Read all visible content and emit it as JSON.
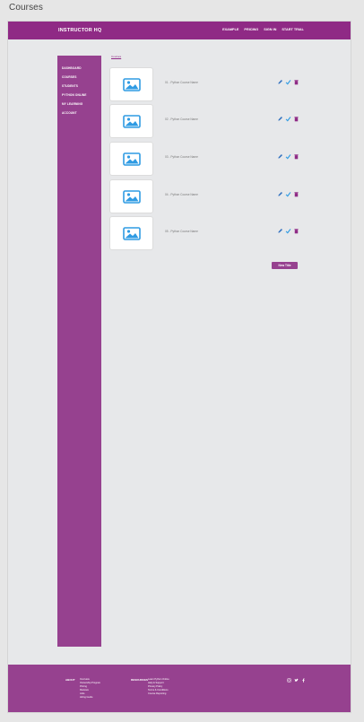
{
  "page_label": "Courses",
  "header": {
    "brand": "INSTRUCTOR HQ",
    "nav": [
      "EXAMPLE",
      "PRICING",
      "SIGN IN",
      "START TRIAL"
    ]
  },
  "sidebar": {
    "items": [
      "DASHBOARD",
      "COURSES",
      "STUDENTS",
      "PYTHON ONLINE",
      "MY LEARNING",
      "ACCOUNT"
    ]
  },
  "breadcrumb": "Courses",
  "courses": [
    {
      "name": "01 - Python Course Name"
    },
    {
      "name": "02 - Python Course Name"
    },
    {
      "name": "03 - Python Course Name"
    },
    {
      "name": "04 - Python Course Name"
    },
    {
      "name": "05 - Python Course Name"
    }
  ],
  "new_button_label": "New Title",
  "footer": {
    "col1": {
      "heading": "ABOUT",
      "links": [
        "Overview",
        "Ownership Program",
        "Pricing",
        "Reviews",
        "Jobs",
        "Hiring Guide"
      ]
    },
    "col2": {
      "heading": "RESOURCES",
      "links": [
        "Learn Python Online",
        "Help & Support",
        "Privacy Policy",
        "Terms & Conditions",
        "Course Reporting"
      ]
    },
    "social": [
      "instagram-icon",
      "twitter-icon",
      "facebook-icon"
    ]
  },
  "colors": {
    "brand": "#8f2a85",
    "sidebar": "#96418f",
    "image_icon": "#2f9be3"
  }
}
